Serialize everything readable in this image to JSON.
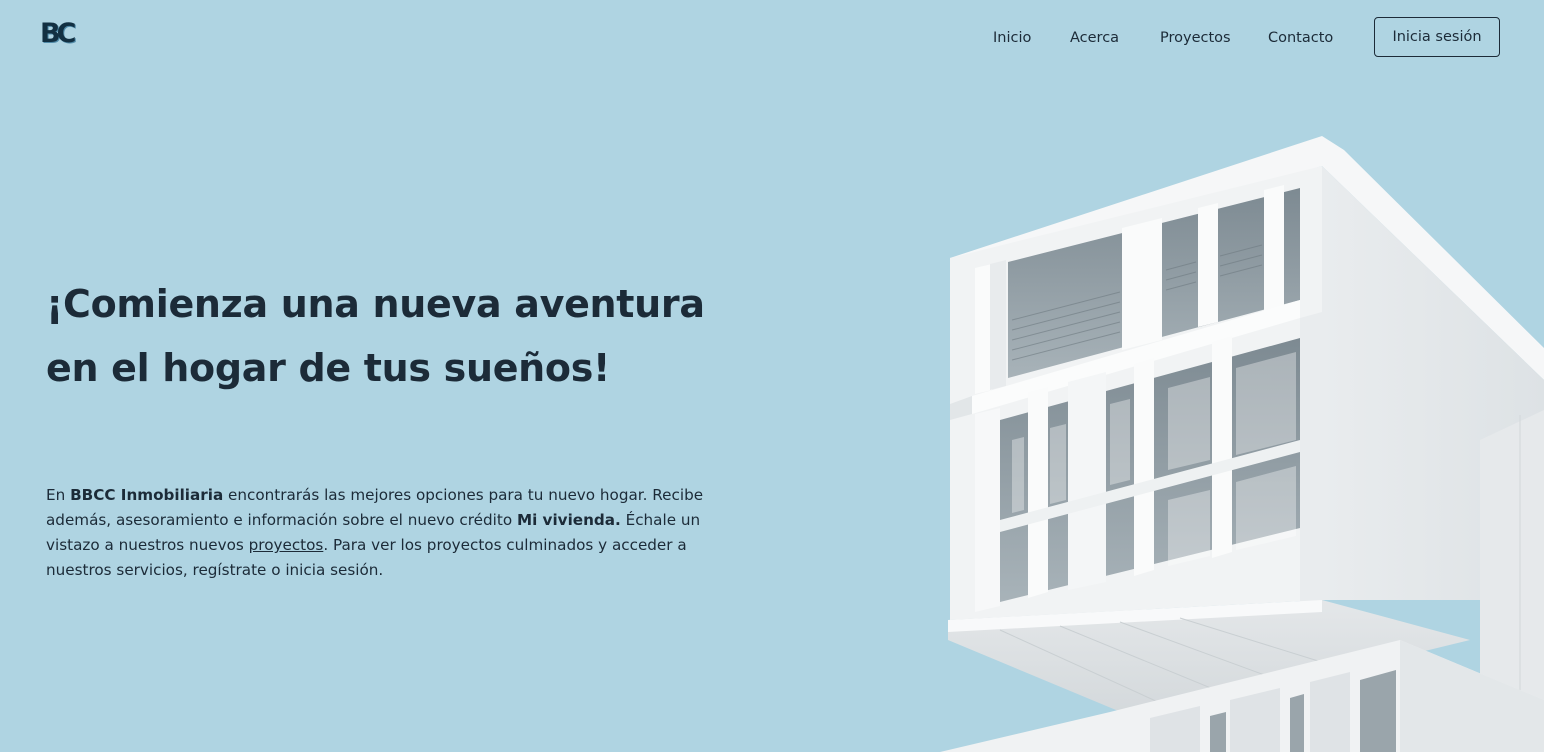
{
  "header": {
    "logo_text": "BC",
    "nav": [
      "Inicio",
      "Acerca",
      "Proyectos",
      "Contacto"
    ],
    "login_label": "Inicia sesión"
  },
  "hero": {
    "title": "¡Comienza una nueva aventura en el hogar de tus sueños!",
    "paragraph": {
      "p1": "En ",
      "brand": "BBCC Inmobiliaria",
      "p2": " encontrarás las mejores opciones para tu nuevo hogar. Recibe además, asesoramiento e información sobre el nuevo crédito ",
      "credit": "Mi vivienda.",
      "p3": " Échale un vistazo a nuestros nuevos ",
      "projects_link": "proyectos",
      "p4": ". Para ver los proyectos culminados y acceder a nuestros servicios, regístrate o inicia sesión."
    }
  },
  "colors": {
    "background": "#afd4e2",
    "text": "#1c2b38",
    "building_light": "#f2f3f4",
    "building_shadow": "#d7dcdf",
    "glass": "#8c98a0"
  },
  "icons": {
    "building_image": "modern-white-building-photo"
  }
}
